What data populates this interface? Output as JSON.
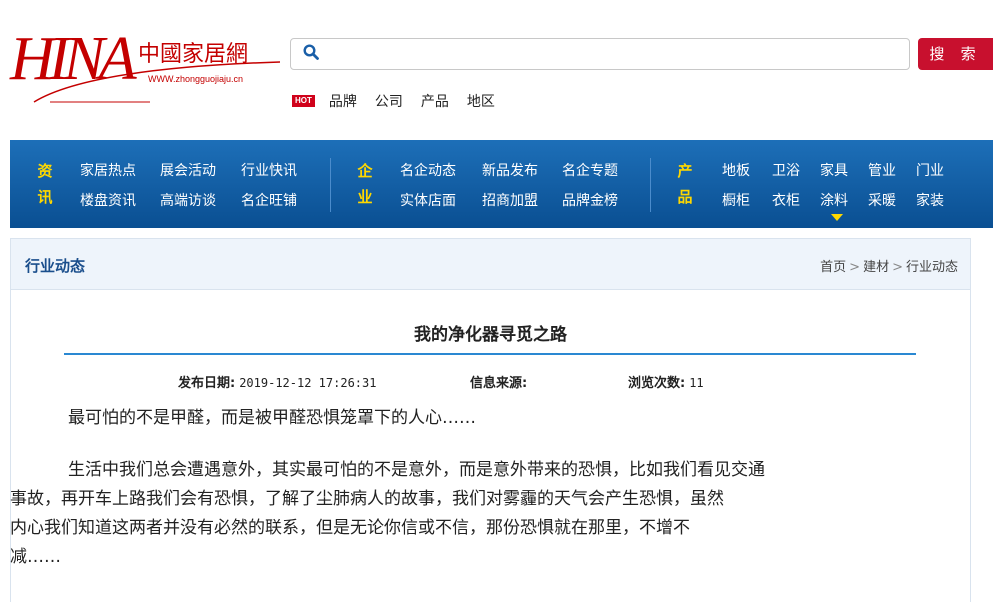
{
  "logo": {
    "mark": "HINA",
    "site_name_cn": "中國家居網",
    "site_url": "WWW.zhongguojiaju.cn"
  },
  "search": {
    "value": "",
    "placeholder": "",
    "button_label": "搜 索"
  },
  "quick_links": {
    "badge": "HOT",
    "items": [
      "品牌",
      "公司",
      "产品",
      "地区"
    ]
  },
  "nav": {
    "groups": [
      {
        "head": [
          "资",
          "讯"
        ],
        "row1": [
          "家居热点",
          "展会活动",
          "行业快讯"
        ],
        "row2": [
          "楼盘资讯",
          "高端访谈",
          "名企旺铺"
        ]
      },
      {
        "head": [
          "企",
          "业"
        ],
        "row1": [
          "名企动态",
          "新品发布",
          "名企专题"
        ],
        "row2": [
          "实体店面",
          "招商加盟",
          "品牌金榜"
        ]
      },
      {
        "head": [
          "产",
          "品"
        ],
        "row1": [
          "地板",
          "卫浴",
          "家具",
          "管业",
          "门业"
        ],
        "row2": [
          "橱柜",
          "衣柜",
          "涂料",
          "采暖",
          "家装"
        ]
      }
    ],
    "active_item": "涂料"
  },
  "panel": {
    "title": "行业动态",
    "breadcrumb": [
      "首页",
      "建材",
      "行业动态"
    ],
    "breadcrumb_sep": ">"
  },
  "article": {
    "title": "我的净化器寻觅之路",
    "meta": {
      "date_label": "发布日期:",
      "date_value": "2019-12-12 17:26:31",
      "source_label": "信息来源:",
      "source_value": "",
      "views_label": "浏览次数:",
      "views_value": "11"
    },
    "paragraphs": [
      "最可怕的不是甲醛，而是被甲醛恐惧笼罩下的人心……",
      "生活中我们总会遭遇意外，其实最可怕的不是意外，而是意外带来的恐惧，比如我们看见交通",
      "事故，再开车上路我们会有恐惧，了解了尘肺病人的故事，我们对雾霾的天气会产生恐惧，虽然",
      "内心我们知道这两者并没有必然的联系，但是无论你信或不信，那份恐惧就在那里，不增不",
      "减……"
    ]
  },
  "colors": {
    "brand_red": "#c8102e",
    "nav_blue": "#0a4f92",
    "nav_head_yellow": "#ffd800",
    "title_rule_blue": "#2a88d2"
  }
}
